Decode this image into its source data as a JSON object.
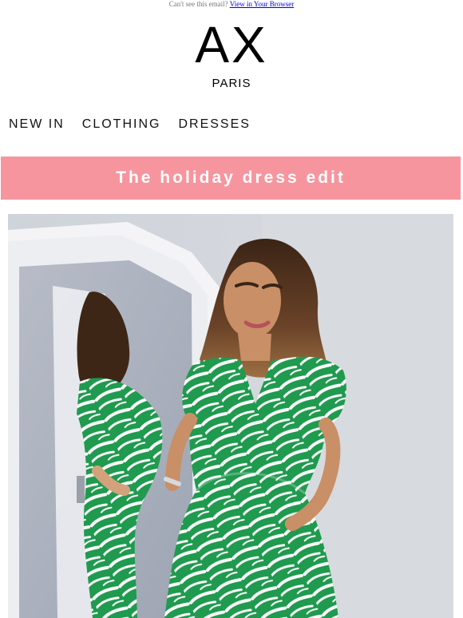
{
  "top": {
    "prefix": "Can't see this email?",
    "link": "View in Your Browser"
  },
  "brand": {
    "mark": "AX",
    "sub": "PARIS"
  },
  "nav": [
    "NEW IN",
    "CLOTHING",
    "DRESSES"
  ],
  "banner": {
    "text": "The holiday dress edit",
    "color": "#f7959e"
  }
}
